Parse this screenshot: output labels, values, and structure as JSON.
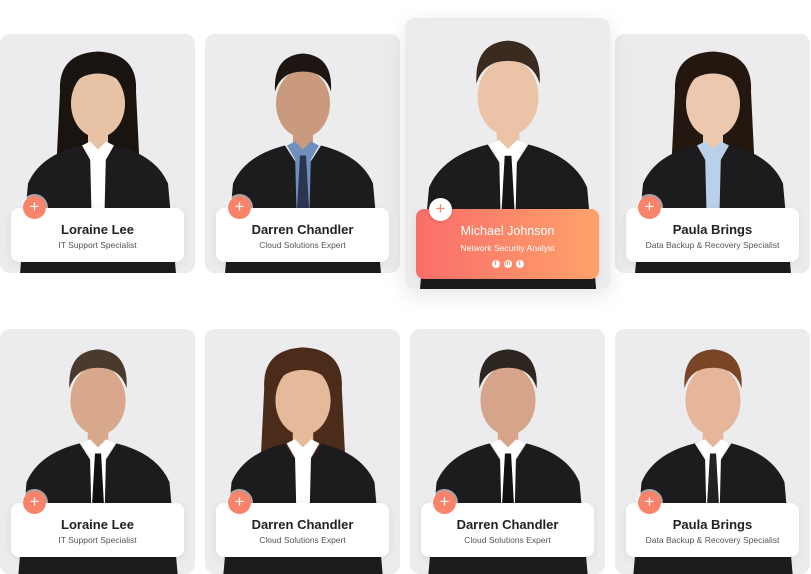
{
  "team": [
    {
      "name": "Loraine Lee",
      "role": "IT Support Specialist",
      "gender": "female",
      "hair": "#1a1411",
      "skin": "#e8c2a5",
      "shirt": "#ffffff",
      "tie": ""
    },
    {
      "name": "Darren Chandler",
      "role": "Cloud Solutions Expert",
      "gender": "male",
      "hair": "#1d1612",
      "skin": "#c99a7c",
      "shirt": "#6f8fbd",
      "tie": "#2c3550"
    },
    {
      "name": "Michael Johnson",
      "role": "Network Security Analyst",
      "gender": "male",
      "hair": "#3a2a20",
      "skin": "#ebc4a8",
      "shirt": "#ffffff",
      "tie": "#151515",
      "highlighted": true,
      "socials": [
        "f",
        "in",
        "t"
      ]
    },
    {
      "name": "Paula Brings",
      "role": "Data Backup & Recovery Specialist",
      "gender": "female",
      "hair": "#24170f",
      "skin": "#ecc8ae",
      "shirt": "#b9d0ea",
      "tie": ""
    },
    {
      "name": "Loraine Lee",
      "role": "IT Support Specialist",
      "gender": "male",
      "hair": "#4a3a2e",
      "skin": "#d7a88b",
      "shirt": "#ffffff",
      "tie": "#111111"
    },
    {
      "name": "Darren Chandler",
      "role": "Cloud Solutions Expert",
      "gender": "female",
      "hair": "#4b2b1a",
      "skin": "#e6b99a",
      "shirt": "#ffffff",
      "tie": ""
    },
    {
      "name": "Darren Chandler",
      "role": "Cloud Solutions Expert",
      "gender": "male",
      "hair": "#2c2520",
      "skin": "#d6a589",
      "shirt": "#ffffff",
      "tie": "#111111"
    },
    {
      "name": "Paula Brings",
      "role": "Data Backup & Recovery Specialist",
      "gender": "male",
      "hair": "#7a4426",
      "skin": "#e6b69a",
      "shirt": "#ffffff",
      "tie": "#222222"
    }
  ],
  "colors": {
    "accent_start": "#f96e6a",
    "accent_end": "#ffa26a",
    "card_bg": "#e9e9eb",
    "suit": "#1c1c1f"
  },
  "icons": {
    "plus": "+",
    "plus_icon_name": "plus-icon"
  }
}
